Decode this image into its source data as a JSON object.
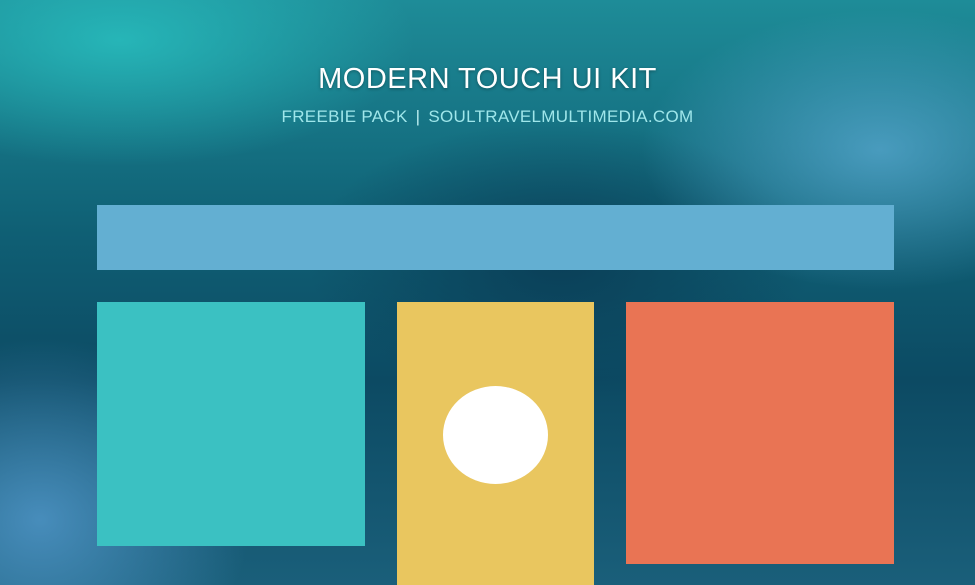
{
  "header": {
    "title": "MODERN TOUCH UI KIT",
    "subtitle_left": "FREEBIE PACK",
    "separator": "|",
    "subtitle_right": "SOULTRAVELMULTIMEDIA.COM"
  },
  "colors": {
    "banner": "#63afd2",
    "teal_tile": "#3bc1c2",
    "yellow_tile": "#e9c65f",
    "orange_tile": "#e97454",
    "circle": "#ffffff"
  }
}
